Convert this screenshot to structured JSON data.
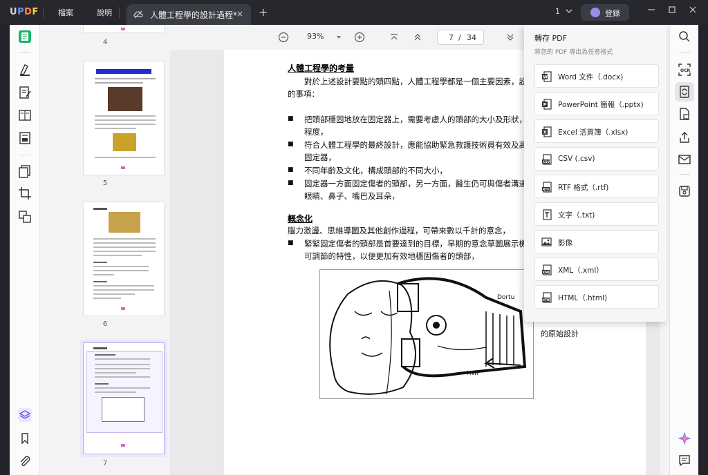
{
  "app": {
    "logo": "UPDF"
  },
  "menu": {
    "file": "檔案",
    "help": "說明"
  },
  "tab": {
    "title": "人體工程學的設計過程*",
    "close": "×",
    "add": "+"
  },
  "titlebar": {
    "page_count": "1",
    "login": "登錄"
  },
  "toolbar": {
    "zoom": "93%",
    "current_page": "7",
    "total_pages": "34",
    "slash": "/"
  },
  "thumbnails": [
    {
      "number": "4"
    },
    {
      "number": "5"
    },
    {
      "number": "6"
    },
    {
      "number": "7"
    }
  ],
  "document": {
    "heading1": "人體工程學的考量",
    "para1_line1": "對於上述設計要點的頭四點，人體工程學都是一個主要因素，設計",
    "para1_line2": "的事項：",
    "bullets": [
      {
        "line1": "把頭部穩固地放在固定器上，需要考慮人的頭部的大小及形狀，同",
        "line2": "程度，"
      },
      {
        "line1": "符合人體工程學的最終設計，應能協助緊急救護技術員有效及高效",
        "line2": "固定器，"
      },
      {
        "line1": "不同年齡及文化，構成頭部的不同大小，",
        "line2": ""
      },
      {
        "line1": "固定器一方面固定傷者的頭部，另一方面，醫生仍可與傷者溝通，",
        "line2": "眼睛、鼻子、嘴巴及耳朵，"
      }
    ],
    "heading2": "概念化",
    "para2": "腦力激盪、思維導圖及其他創作過程，可帶來數以千計的意念，",
    "bullet2_line1": "緊緊固定傷者的頭部是首要達到的目標，早期的意念草圖展示機制",
    "bullet2_line2": "可調節的特性，以便更加有效地穩固傷者的頭部，",
    "tail_text": "的原始設計"
  },
  "export_panel": {
    "title": "轉存 PDF",
    "subtitle": "將您的 PDF 導出為任意格式",
    "items": [
      {
        "label": "Word 文件（.docx)",
        "icon": "word-icon",
        "color": "#2b5797"
      },
      {
        "label": "PowerPoint 簡報（.pptx)",
        "icon": "powerpoint-icon",
        "color": "#c43e1c"
      },
      {
        "label": "Excel 活頁簿（.xlsx)",
        "icon": "excel-icon",
        "color": "#217346"
      },
      {
        "label": "CSV (.csv)",
        "icon": "csv-icon",
        "color": "#555555"
      },
      {
        "label": "RTF 格式（.rtf)",
        "icon": "rtf-icon",
        "color": "#555555"
      },
      {
        "label": "文字（.txt)",
        "icon": "txt-icon",
        "color": "#555555"
      },
      {
        "label": "影像",
        "icon": "image-icon",
        "color": "#555555"
      },
      {
        "label": "XML（.xml）",
        "icon": "xml-icon",
        "color": "#555555"
      },
      {
        "label": "HTML（.html)",
        "icon": "html-icon",
        "color": "#555555"
      }
    ]
  },
  "colors": {
    "accent": "#6f4cf0",
    "titlebar": "#26282e",
    "green": "#1db368"
  }
}
